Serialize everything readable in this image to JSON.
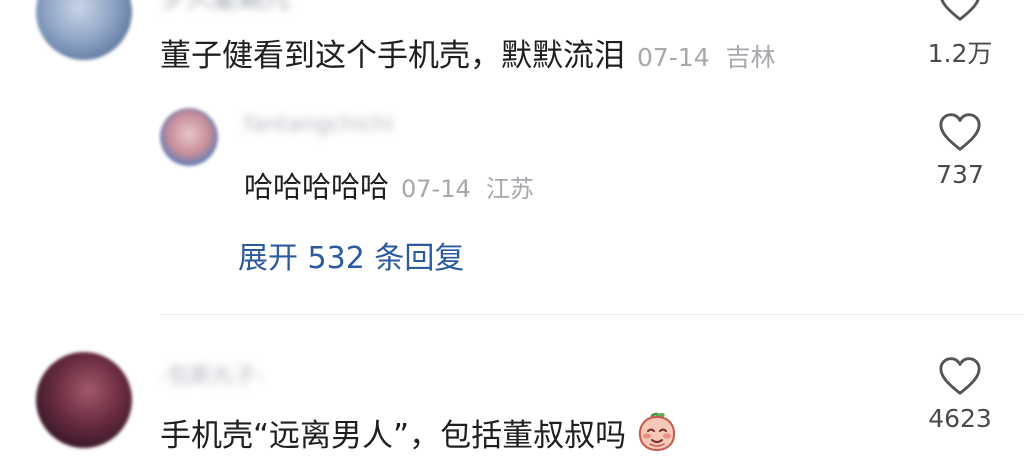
{
  "comments": [
    {
      "user": "夕人星期九",
      "text": "董子健看到这个手机壳，默默流泪",
      "date": "07-14",
      "location": "吉林",
      "likes": "1.2万"
    },
    {
      "user": "fantangchichi",
      "text": "哈哈哈哈哈",
      "date": "07-14",
      "location": "江苏",
      "likes": "737"
    },
    {
      "user": "-包斯丸子-",
      "text": "手机壳“远离男人”，包括董叔叔吗",
      "date": "",
      "location": "",
      "likes": "4623"
    }
  ],
  "expand_replies_label": "展开 532 条回复",
  "icons": {
    "like": "heart-outline-icon",
    "emoji": "blushing-peach-emoji"
  },
  "colors": {
    "link": "#2c5a9e",
    "meta": "#a5a8ad",
    "text": "#1f1f1f"
  }
}
